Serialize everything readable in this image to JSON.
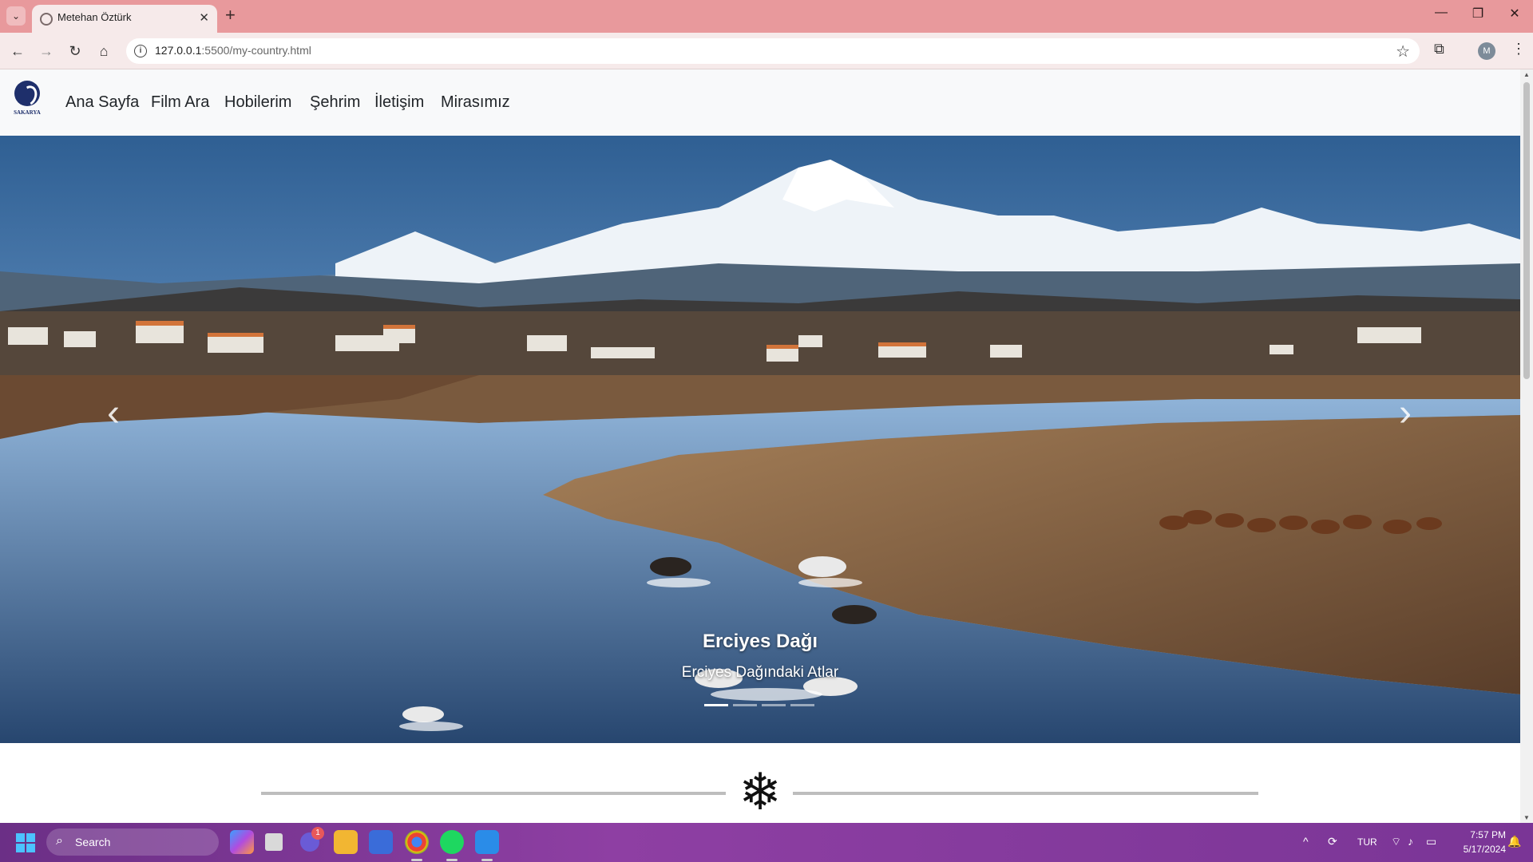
{
  "browser": {
    "tab_title": "Metehan Öztürk",
    "url_host": "127.0.0.1",
    "url_path": ":5500/my-country.html",
    "profile_initial": "M"
  },
  "site": {
    "logo_text": "SAKARYA",
    "nav_links": [
      "Ana Sayfa",
      "Film Ara",
      "Hobilerim",
      "Şehrim",
      "İletişim",
      "Mirasımız"
    ]
  },
  "carousel": {
    "caption_title": "Erciyes Dağı",
    "caption_subtitle": "Erciyes Dağındaki Atlar",
    "slide_count": 4,
    "active_slide": 1
  },
  "taskbar": {
    "search_label": "Search",
    "notification_count": "1",
    "language": "TUR",
    "time": "7:57 PM",
    "date": "5/17/2024"
  },
  "colors": {
    "chrome_accent": "#e8999c",
    "taskbar": "#7a3596"
  }
}
